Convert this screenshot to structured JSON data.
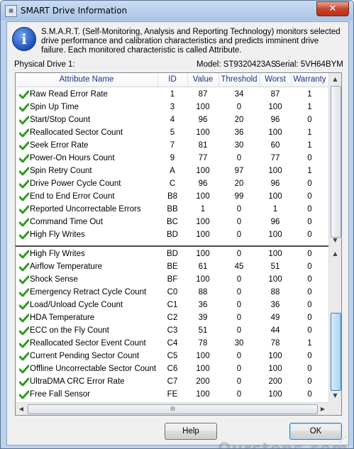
{
  "window": {
    "title": "SMART Drive Information",
    "close_label": "✕"
  },
  "info": {
    "icon": "info-icon",
    "text": "S.M.A.R.T. (Self-Monitoring, Analysis and Reporting Technology) monitors selected drive performance and calibration characteristics and predicts imminent drive failure. Each monitored characteristic is called Attribute."
  },
  "drive": {
    "label": "Physical Drive 1:",
    "model": "Model: ST9320423AS",
    "serial": "Serial: 5VH64BYM"
  },
  "table": {
    "columns": [
      "Attribute Name",
      "ID",
      "Value",
      "Threshold",
      "Worst",
      "Warranty"
    ],
    "top_rows": [
      [
        "Raw Read Error Rate",
        "1",
        "87",
        "34",
        "87",
        "1"
      ],
      [
        "Spin Up Time",
        "3",
        "100",
        "0",
        "100",
        "1"
      ],
      [
        "Start/Stop Count",
        "4",
        "96",
        "20",
        "96",
        "0"
      ],
      [
        "Reallocated Sector Count",
        "5",
        "100",
        "36",
        "100",
        "1"
      ],
      [
        "Seek Error Rate",
        "7",
        "81",
        "30",
        "60",
        "1"
      ],
      [
        "Power-On Hours Count",
        "9",
        "77",
        "0",
        "77",
        "0"
      ],
      [
        "Spin Retry Count",
        "A",
        "100",
        "97",
        "100",
        "1"
      ],
      [
        "Drive Power Cycle Count",
        "C",
        "96",
        "20",
        "96",
        "0"
      ],
      [
        "End to End Error Count",
        "B8",
        "100",
        "99",
        "100",
        "0"
      ],
      [
        "Reported Uncorrectable Errors",
        "BB",
        "1",
        "0",
        "1",
        "0"
      ],
      [
        "Command Time Out",
        "BC",
        "100",
        "0",
        "96",
        "0"
      ],
      [
        "High Fly Writes",
        "BD",
        "100",
        "0",
        "100",
        "0"
      ]
    ],
    "bottom_rows": [
      [
        "High Fly Writes",
        "BD",
        "100",
        "0",
        "100",
        "0"
      ],
      [
        "Airflow Temperature",
        "BE",
        "61",
        "45",
        "51",
        "0"
      ],
      [
        "Shock Sense",
        "BF",
        "100",
        "0",
        "100",
        "0"
      ],
      [
        "Emergency Retract Cycle Count",
        "C0",
        "88",
        "0",
        "88",
        "0"
      ],
      [
        "Load/Unload Cycle Count",
        "C1",
        "36",
        "0",
        "36",
        "0"
      ],
      [
        "HDA Temperature",
        "C2",
        "39",
        "0",
        "49",
        "0"
      ],
      [
        "ECC on the Fly Count",
        "C3",
        "51",
        "0",
        "44",
        "0"
      ],
      [
        "Reallocated Sector Event Count",
        "C4",
        "78",
        "30",
        "78",
        "1"
      ],
      [
        "Current Pending Sector Count",
        "C5",
        "100",
        "0",
        "100",
        "0"
      ],
      [
        "Offline Uncorrectable Sector Count",
        "C6",
        "100",
        "0",
        "100",
        "0"
      ],
      [
        "UltraDMA CRC Error Rate",
        "C7",
        "200",
        "0",
        "200",
        "0"
      ],
      [
        "Free Fall Sensor",
        "FE",
        "100",
        "0",
        "100",
        "0"
      ]
    ]
  },
  "scroll": {
    "up": "▲",
    "down": "▼",
    "left": "◀",
    "right": "▶",
    "grip": "III"
  },
  "buttons": {
    "help": "Help",
    "ok": "OK"
  },
  "watermark": "Oursteps.com.au",
  "colors": {
    "accent": "#3c7fb1",
    "header_text": "#1e3287",
    "check": "#2f9a20"
  }
}
